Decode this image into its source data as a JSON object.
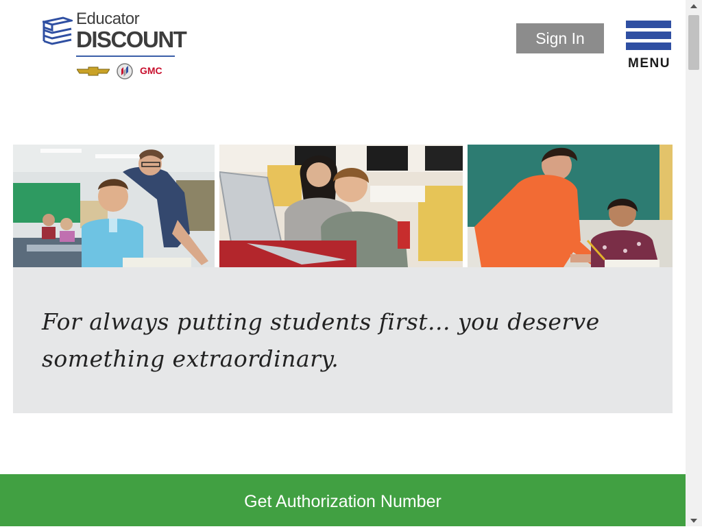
{
  "header": {
    "logo_line1": "Educator",
    "logo_line2": "DISCOUNT",
    "brand_gmc": "GMC",
    "sign_in_label": "Sign In",
    "menu_label": "MENU"
  },
  "hero": {
    "tagline": "For always putting students first... you deserve something extraordinary.",
    "photos": [
      {
        "icon": "teacher-helping-student-photo"
      },
      {
        "icon": "teacher-and-student-laptop-photo"
      },
      {
        "icon": "teacher-and-girl-writing-photo"
      }
    ]
  },
  "cta": {
    "label": "Get Authorization Number"
  },
  "colors": {
    "menu_blue": "#2f4fa2",
    "sign_in_gray": "#8c8c8c",
    "cta_green": "#41a042",
    "hero_gray": "#e6e7e8",
    "gmc_red": "#c8102e"
  }
}
